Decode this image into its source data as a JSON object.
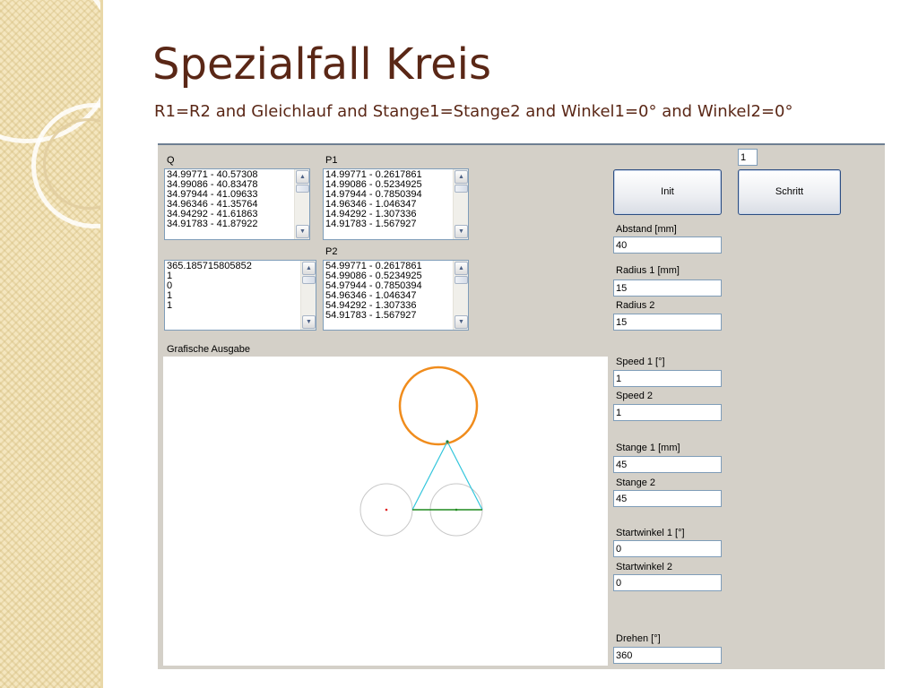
{
  "slide": {
    "title": "Spezialfall Kreis",
    "subtitle": "R1=R2 and Gleichlauf and Stange1=Stange2 and Winkel1=0° and Winkel2=0°"
  },
  "app": {
    "lists": {
      "q": {
        "label": "Q",
        "items": [
          "34.99771 - 40.57308",
          "34.99086 - 40.83478",
          "34.97944 - 41.09633",
          "34.96346 - 41.35764",
          "34.94292 - 41.61863",
          "34.91783 - 41.87922"
        ]
      },
      "p1": {
        "label": "P1",
        "items": [
          "14.99771 - 0.2617861",
          "14.99086 - 0.5234925",
          "14.97944 - 0.7850394",
          "14.96346 - 1.046347",
          "14.94292 - 1.307336",
          "14.91783 - 1.567927"
        ]
      },
      "misc": {
        "items": [
          "365.185715805852",
          "1",
          "0",
          "1",
          "1"
        ]
      },
      "p2": {
        "label": "P2",
        "items": [
          "54.99771 - 0.2617861",
          "54.99086 - 0.5234925",
          "54.97944 - 0.7850394",
          "54.96346 - 1.046347",
          "54.94292 - 1.307336",
          "54.91783 - 1.567927"
        ]
      }
    },
    "canvas_label": "Grafische Ausgabe",
    "step_value": "1",
    "buttons": {
      "init": "Init",
      "step": "Schritt"
    },
    "fields": {
      "abstand": {
        "label": "Abstand [mm]",
        "value": "40"
      },
      "radius1": {
        "label": "Radius 1 [mm]",
        "value": "15"
      },
      "radius2": {
        "label": "Radius 2",
        "value": "15"
      },
      "speed1": {
        "label": "Speed 1 [°]",
        "value": "1"
      },
      "speed2": {
        "label": "Speed 2",
        "value": "1"
      },
      "stange1": {
        "label": "Stange 1 [mm]",
        "value": "45"
      },
      "stange2": {
        "label": "Stange 2",
        "value": "45"
      },
      "startwinkel1": {
        "label": "Startwinkel 1 [°]",
        "value": "0"
      },
      "startwinkel2": {
        "label": "Startwinkel 2",
        "value": "0"
      },
      "drehen": {
        "label": "Drehen [°]",
        "value": "360"
      }
    },
    "colors": {
      "trace": "#f08c1c",
      "rods": "#34c6dc",
      "base_line": "#1f8a1f",
      "crank_circles": "#c8c8c8",
      "center_dot": "#e02020"
    }
  }
}
